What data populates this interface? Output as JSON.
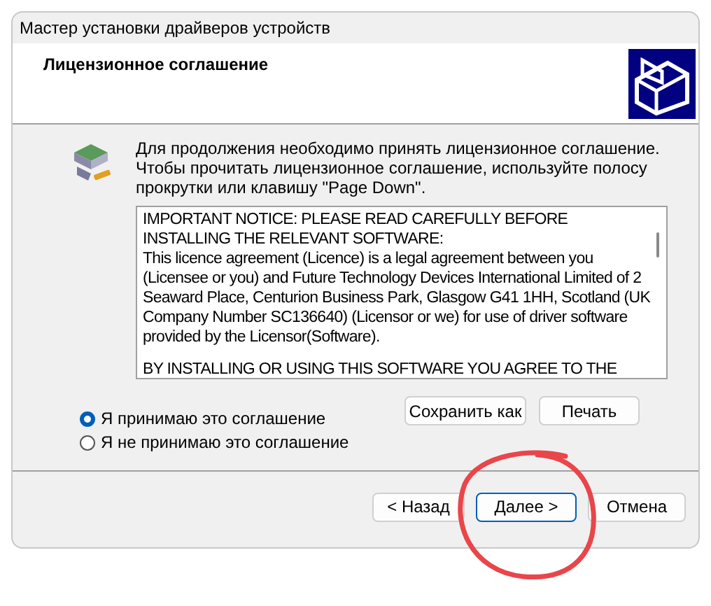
{
  "window": {
    "title": "Мастер установки драйверов устройств"
  },
  "header": {
    "title": "Лицензионное соглашение"
  },
  "instructions": [
    "Для продолжения необходимо принять лицензионное соглашение.",
    "Чтобы прочитать лицензионное соглашение, используйте полосу",
    "прокрутки или клавишу \"Page Down\"."
  ],
  "license_text": [
    {
      "lines": [
        "IMPORTANT NOTICE: PLEASE READ CAREFULLY BEFORE",
        "INSTALLING THE RELEVANT SOFTWARE:",
        "This licence agreement (Licence) is a legal agreement between you",
        "(Licensee or you) and Future Technology Devices International Limited of 2",
        "Seaward Place, Centurion Business Park, Glasgow G41 1HH, Scotland (UK",
        "Company Number SC136640) (Licensor or we) for use of driver software",
        "provided by the Licensor(Software)."
      ]
    },
    {
      "lines": [
        "BY INSTALLING OR USING THIS SOFTWARE YOU AGREE TO THE"
      ]
    }
  ],
  "options": [
    {
      "label": "Я принимаю это соглашение",
      "selected": true
    },
    {
      "label": "Я не принимаю это соглашение",
      "selected": false
    }
  ],
  "side_buttons": [
    "Сохранить как",
    "Печать"
  ],
  "footer_buttons": [
    {
      "label": "< Назад",
      "default": false
    },
    {
      "label": "Далее >",
      "default": true
    },
    {
      "label": "Отмена",
      "default": false
    }
  ]
}
